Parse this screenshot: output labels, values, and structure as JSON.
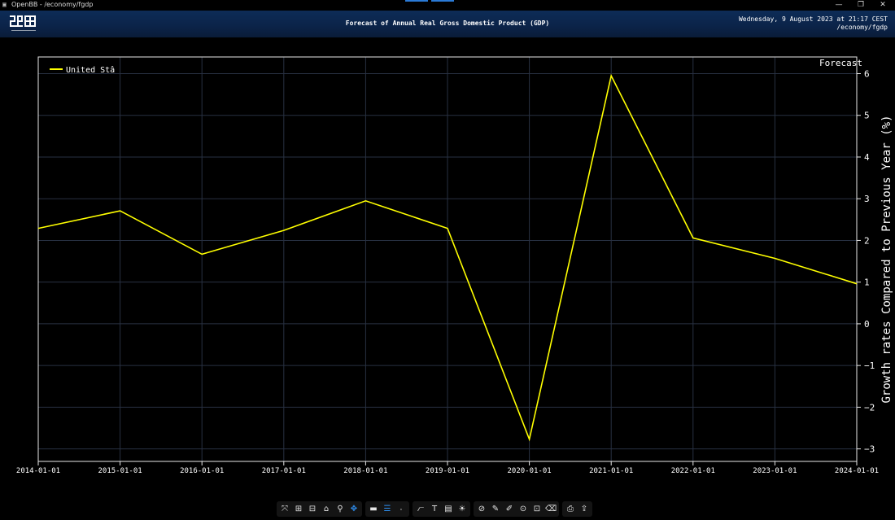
{
  "window": {
    "title": "OpenBB - /economy/fgdp",
    "icon": "openbb-app-icon",
    "minimize_glyph": "—",
    "restore_glyph": "❐",
    "close_glyph": "✕"
  },
  "header": {
    "logo": "openbb-logo",
    "title": "Forecast of Annual Real Gross Domestic Product (GDP)",
    "datetime": "Wednesday, 9 August 2023 at 21:17 CEST",
    "route": "/economy/fgdp"
  },
  "chart_data": {
    "type": "line",
    "title": "Forecast of Annual Real Gross Domestic Product (GDP)",
    "annotation": "Forecast",
    "ylabel": "Growth rates Compared to Previous Year (%)",
    "xlabel": "",
    "x": [
      "2014-01-01",
      "2015-01-01",
      "2016-01-01",
      "2017-01-01",
      "2018-01-01",
      "2019-01-01",
      "2020-01-01",
      "2021-01-01",
      "2022-01-01",
      "2023-01-01",
      "2024-01-01"
    ],
    "series": [
      {
        "name": "United States",
        "legend_text": "United Stâ",
        "color": "#ffff00",
        "values": [
          2.29,
          2.71,
          1.67,
          2.24,
          2.95,
          2.29,
          -2.77,
          5.95,
          2.06,
          1.57,
          0.96
        ]
      }
    ],
    "ylim": [
      -3.3,
      6.4
    ],
    "yticks": [
      6,
      5,
      4,
      3,
      2,
      1,
      0,
      -1,
      -2,
      -3
    ],
    "ytick_labels": [
      "6",
      "5",
      "4",
      "3",
      "2",
      "1",
      "0",
      "−1",
      "−2",
      "−3"
    ],
    "grid": true,
    "legend_position": "top-left",
    "y_axis_side": "right",
    "colors": {
      "background": "#000000",
      "grid": "#283142",
      "axis": "#e8e8e8",
      "line": "#ffff00"
    }
  },
  "toolbar": {
    "groups": [
      [
        {
          "name": "autoscale-icon",
          "glyph": "⤧",
          "active": false
        },
        {
          "name": "zoom-in-icon",
          "glyph": "⊞",
          "active": false
        },
        {
          "name": "zoom-out-icon",
          "glyph": "⊟",
          "active": false
        },
        {
          "name": "reset-axes-icon",
          "glyph": "⌂",
          "active": false
        },
        {
          "name": "zoom-icon",
          "glyph": "⚲",
          "active": false
        },
        {
          "name": "pan-icon",
          "glyph": "✥",
          "active": true
        }
      ],
      [
        {
          "name": "spike-lines-icon",
          "glyph": "▬",
          "active": false
        },
        {
          "name": "hover-compare-icon",
          "glyph": "☰",
          "active": true
        },
        {
          "name": "hover-closest-icon",
          "glyph": "⸳",
          "active": false
        }
      ],
      [
        {
          "name": "log-axis-icon",
          "glyph": "⦧",
          "active": false
        },
        {
          "name": "text-annotation-icon",
          "glyph": "T",
          "active": false
        },
        {
          "name": "table-icon",
          "glyph": "▤",
          "active": false
        },
        {
          "name": "theme-toggle-icon",
          "glyph": "☀",
          "active": false
        }
      ],
      [
        {
          "name": "draw-line-icon",
          "glyph": "⊘",
          "active": false
        },
        {
          "name": "draw-open-path-icon",
          "glyph": "✎",
          "active": false
        },
        {
          "name": "draw-closed-path-icon",
          "glyph": "✐",
          "active": false
        },
        {
          "name": "draw-circle-icon",
          "glyph": "⊙",
          "active": false
        },
        {
          "name": "draw-rect-icon",
          "glyph": "⊡",
          "active": false
        },
        {
          "name": "erase-shape-icon",
          "glyph": "⌫",
          "active": false
        }
      ],
      [
        {
          "name": "download-image-icon",
          "glyph": "⎙",
          "active": false
        },
        {
          "name": "export-data-icon",
          "glyph": "⇪",
          "active": false
        }
      ]
    ]
  }
}
